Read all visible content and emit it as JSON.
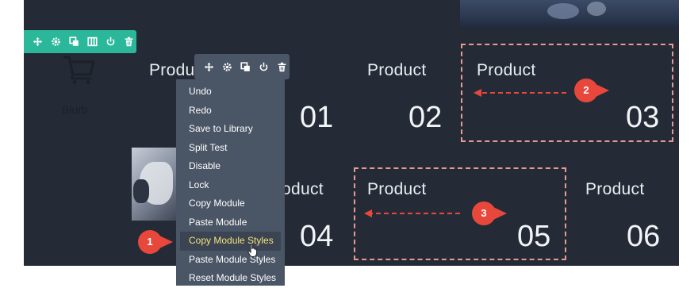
{
  "row_toolbar": {
    "icons": [
      "move-icon",
      "settings-icon",
      "duplicate-icon",
      "columns-icon",
      "power-icon",
      "trash-icon"
    ]
  },
  "module_toolbar": {
    "icons": [
      "move-icon",
      "settings-icon",
      "duplicate-icon",
      "power-icon",
      "trash-icon"
    ]
  },
  "blurb": {
    "label": "Blurb",
    "icon": "cart-icon"
  },
  "products": [
    {
      "title": "Produ",
      "number": "01"
    },
    {
      "title": "Product",
      "number": "02"
    },
    {
      "title": "Product",
      "number": "03"
    },
    {
      "title": "oduct",
      "number": "04"
    },
    {
      "title": "Product",
      "number": "05"
    },
    {
      "title": "Product",
      "number": "06"
    }
  ],
  "context_menu": {
    "items": [
      "Undo",
      "Redo",
      "Save to Library",
      "Split Test",
      "Disable",
      "Lock",
      "Copy Module",
      "Paste Module",
      "Copy Module Styles",
      "Paste Module Styles",
      "Reset Module Styles"
    ],
    "active_index": 8
  },
  "annotations": {
    "badges": [
      "1",
      "2",
      "3"
    ],
    "badge_color": "#e8483c",
    "dash_color": "#e99a8f"
  },
  "colors": {
    "canvas": "#242b36",
    "row_toolbar": "#2bb89a",
    "module_toolbar": "#4a5565",
    "menu_active_text": "#f6e27a"
  }
}
